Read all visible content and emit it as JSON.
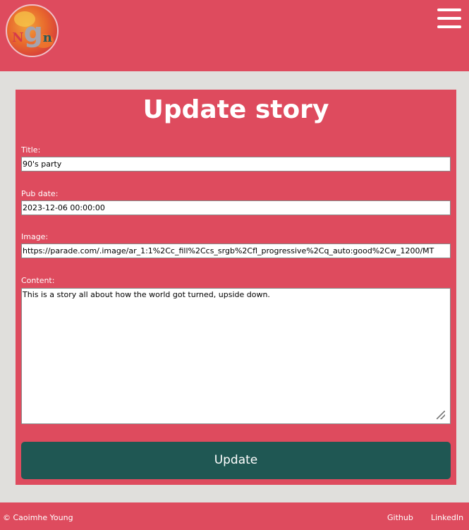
{
  "header": {
    "logo_letters": [
      "N",
      "g",
      "n"
    ],
    "menu_icon": "hamburger-menu-icon"
  },
  "form": {
    "heading": "Update story",
    "fields": {
      "title": {
        "label": "Title:",
        "value": "90's party"
      },
      "pub_date": {
        "label": "Pub date:",
        "value": "2023-12-06 00:00:00"
      },
      "image": {
        "label": "Image:",
        "value": "https://parade.com/.image/ar_1:1%2Cc_fill%2Ccs_srgb%2Cfl_progressive%2Cq_auto:good%2Cw_1200/MT"
      },
      "content": {
        "label": "Content:",
        "value": "This is a story all about how the world got turned, upside down."
      }
    },
    "submit_label": "Update"
  },
  "footer": {
    "copyright": "© Caoimhe Young",
    "links": [
      "Github",
      "LinkedIn"
    ]
  },
  "colors": {
    "primary": "#de4b5e",
    "button": "#1f5753",
    "page_background": "#e0dfdc"
  }
}
